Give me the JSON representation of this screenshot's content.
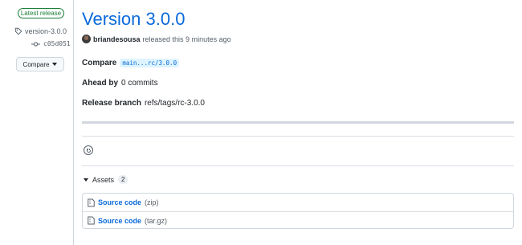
{
  "sidebar": {
    "latest_badge": "Latest release",
    "tag": "version-3.0.0",
    "commit": "c05d051",
    "compare_label": "Compare"
  },
  "release": {
    "title": "Version 3.0.0",
    "author": "briandesousa",
    "released_text": "released this 9 minutes ago",
    "compare_label": "Compare",
    "compare_ref": "main...rc/3.0.0",
    "ahead_label": "Ahead by",
    "ahead_value": "0 commits",
    "branch_label": "Release branch",
    "branch_value": "refs/tags/rc-3.0.0"
  },
  "assets": {
    "label": "Assets",
    "count": "2",
    "items": [
      {
        "name": "Source code",
        "format": "(zip)"
      },
      {
        "name": "Source code",
        "format": "(tar.gz)"
      }
    ]
  },
  "colors": {
    "accent": "#0969da",
    "success": "#1a7f37",
    "border": "#d0d7de"
  }
}
